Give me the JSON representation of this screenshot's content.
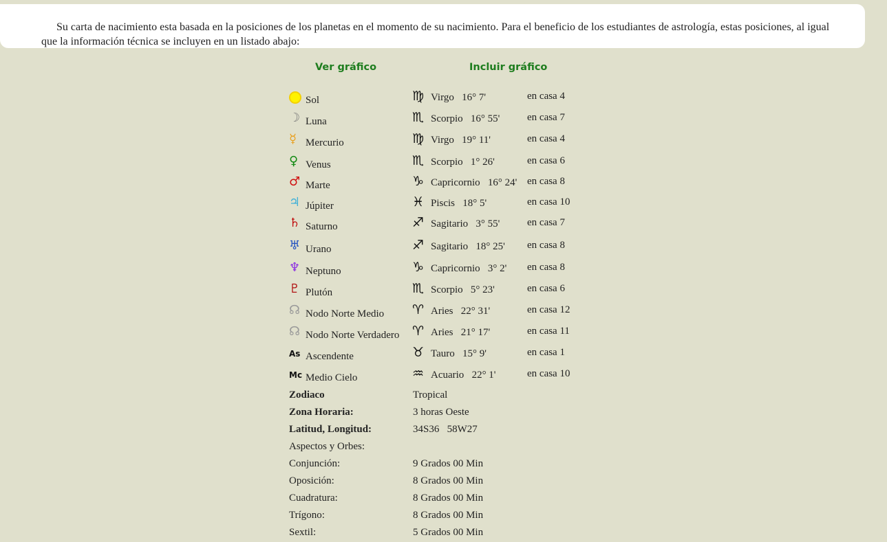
{
  "intro": {
    "text": "Su carta de nacimiento esta basada en la posiciones de los planetas en el momento de su nacimiento. Para el beneficio de los estudiantes de astrología, estas posiciones, al igual que la información técnica se incluyen en un listado abajo:"
  },
  "links": {
    "view_chart": "Ver gráfico",
    "include_chart": "Incluir gráfico"
  },
  "colors": {
    "background": "#e0e0cc",
    "link": "#1e7d1e",
    "sun": "#fff200",
    "moon": "#777777",
    "mercury": "#e8a020",
    "venus": "#138a13",
    "mars": "#d01010",
    "jupiter": "#3fb0d8",
    "saturn": "#c01010",
    "uranus": "#2050c0",
    "neptune": "#8a2be2",
    "pluto": "#b01010",
    "node": "#999999"
  },
  "positions": [
    {
      "planet": "Sol",
      "planet_icon": "sun-icon",
      "sign_symbol": "♍",
      "sign_icon": "virgo-icon",
      "sign": "Virgo",
      "degree": "16° 7'",
      "house": "en casa 4"
    },
    {
      "planet": "Luna",
      "planet_icon": "moon-icon",
      "sign_symbol": "♏",
      "sign_icon": "scorpio-icon",
      "sign": "Scorpio",
      "degree": "16° 55'",
      "house": "en casa 7"
    },
    {
      "planet": "Mercurio",
      "planet_icon": "mercury-icon",
      "sign_symbol": "♍",
      "sign_icon": "virgo-icon",
      "sign": "Virgo",
      "degree": "19° 11'",
      "house": "en casa 4"
    },
    {
      "planet": "Venus",
      "planet_icon": "venus-icon",
      "sign_symbol": "♏",
      "sign_icon": "scorpio-icon",
      "sign": "Scorpio",
      "degree": "1° 26'",
      "house": "en casa 6"
    },
    {
      "planet": "Marte",
      "planet_icon": "mars-icon",
      "sign_symbol": "♑",
      "sign_icon": "capricorn-icon",
      "sign": "Capricornio",
      "degree": "16° 24'",
      "house": "en casa 8"
    },
    {
      "planet": "Júpiter",
      "planet_icon": "jupiter-icon",
      "sign_symbol": "♓",
      "sign_icon": "pisces-icon",
      "sign": "Piscis",
      "degree": "18° 5'",
      "house": "en casa 10"
    },
    {
      "planet": "Saturno",
      "planet_icon": "saturn-icon",
      "sign_symbol": "♐",
      "sign_icon": "sagittarius-icon",
      "sign": "Sagitario",
      "degree": "3° 55'",
      "house": "en casa 7"
    },
    {
      "planet": "Urano",
      "planet_icon": "uranus-icon",
      "sign_symbol": "♐",
      "sign_icon": "sagittarius-icon",
      "sign": "Sagitario",
      "degree": "18° 25'",
      "house": "en casa 8"
    },
    {
      "planet": "Neptuno",
      "planet_icon": "neptune-icon",
      "sign_symbol": "♑",
      "sign_icon": "capricorn-icon",
      "sign": "Capricornio",
      "degree": "3° 2'",
      "house": "en casa 8"
    },
    {
      "planet": "Plutón",
      "planet_icon": "pluto-icon",
      "sign_symbol": "♏",
      "sign_icon": "scorpio-icon",
      "sign": "Scorpio",
      "degree": "5° 23'",
      "house": "en casa 6"
    },
    {
      "planet": "Nodo Norte Medio",
      "planet_icon": "north-node-icon",
      "sign_symbol": "♈",
      "sign_icon": "aries-icon",
      "sign": "Aries",
      "degree": "22° 31'",
      "house": "en casa 12"
    },
    {
      "planet": "Nodo Norte Verdadero",
      "planet_icon": "north-node-icon",
      "sign_symbol": "♈",
      "sign_icon": "aries-icon",
      "sign": "Aries",
      "degree": "21° 17'",
      "house": "en casa 11"
    },
    {
      "planet": "Ascendente",
      "planet_icon": "ascendant-icon",
      "planet_glyph_text": "As",
      "sign_symbol": "♉",
      "sign_icon": "taurus-icon",
      "sign": "Tauro",
      "degree": "15° 9'",
      "house": "en casa 1"
    },
    {
      "planet": "Medio Cielo",
      "planet_icon": "midheaven-icon",
      "planet_glyph_text": "Mc",
      "sign_symbol": "♒",
      "sign_icon": "aquarius-icon",
      "sign": "Acuario",
      "degree": "22° 1'",
      "house": "en casa 10"
    }
  ],
  "technical": {
    "zodiac_label": "Zodiaco",
    "zodiac_value": "Tropical",
    "timezone_label": "Zona Horaria:",
    "timezone_value": "3 horas Oeste",
    "latlong_label": "Latitud, Longitud:",
    "latlong_value": "34S36   58W27",
    "aspects_label": "Aspectos y Orbes:",
    "conjunction_label": "Conjunción:",
    "conjunction_value": "9 Grados 00 Min",
    "opposition_label": "Oposición:",
    "opposition_value": "8 Grados 00 Min",
    "square_label": "Cuadratura:",
    "square_value": "8 Grados 00 Min",
    "trine_label": "Trígono:",
    "trine_value": "8 Grados 00 Min",
    "sextile_label": "Sextil:",
    "sextile_value": "5 Grados 00 Min"
  }
}
